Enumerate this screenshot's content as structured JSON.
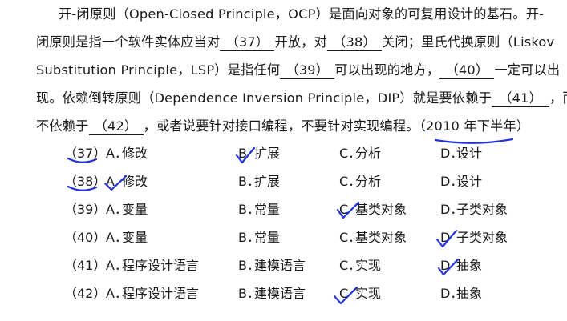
{
  "paragraph": {
    "lines": [
      {
        "text": "开-闭原则（Open-Closed Principle，OCP）是面向对象的可复用设计的基石。开-"
      },
      {
        "pre": "闭原则是指一个软件实体应当对",
        "blank1": "（37）",
        "mid": "开放，对",
        "blank2": "（38）",
        "post": "关闭；里氏代换原则（Liskov"
      },
      {
        "pre": "Substitution Principle，LSP）是指任何",
        "blank1": "（39）",
        "mid": "可以出现的地方，",
        "blank2": "（40）",
        "post": "一定可以出"
      },
      {
        "pre": "现。依赖倒转原则（Dependence Inversion Principle，DIP）就是要依赖于",
        "blank1": "（41）",
        "post": "，而"
      },
      {
        "pre": "不依赖于",
        "blank1": "（42）",
        "mid": "，或者说要针对接口编程，不要针对实现编程。（",
        "source": "2010 年下半年",
        "post": "）"
      }
    ]
  },
  "questions": [
    {
      "num": "（37）",
      "options": [
        {
          "letter": "A．",
          "text": "修改"
        },
        {
          "letter": "B",
          "text": "扩展"
        },
        {
          "letter": "C．",
          "text": "分析"
        },
        {
          "letter": "D．",
          "text": "设计"
        }
      ]
    },
    {
      "num": "（38）",
      "options": [
        {
          "letter": "A",
          "text": "修改"
        },
        {
          "letter": "B．",
          "text": "扩展"
        },
        {
          "letter": "C．",
          "text": "分析"
        },
        {
          "letter": "D．",
          "text": "设计"
        }
      ]
    },
    {
      "num": "（39）",
      "options": [
        {
          "letter": "A．",
          "text": "变量"
        },
        {
          "letter": "B．",
          "text": "常量"
        },
        {
          "letter": "C",
          "text": "基类对象"
        },
        {
          "letter": "D．",
          "text": "子类对象"
        }
      ]
    },
    {
      "num": "（40）",
      "options": [
        {
          "letter": "A．",
          "text": "变量"
        },
        {
          "letter": "B．",
          "text": "常量"
        },
        {
          "letter": "C．",
          "text": "基类对象"
        },
        {
          "letter": "D",
          "text": "子类对象"
        }
      ]
    },
    {
      "num": "（41）",
      "options": [
        {
          "letter": "A．",
          "text": "程序设计语言"
        },
        {
          "letter": "B．",
          "text": "建模语言"
        },
        {
          "letter": "C．",
          "text": "实现"
        },
        {
          "letter": "D",
          "text": "抽象"
        }
      ]
    },
    {
      "num": "（42）",
      "options": [
        {
          "letter": "A．",
          "text": "程序设计语言"
        },
        {
          "letter": "B．",
          "text": "建模语言"
        },
        {
          "letter": "C",
          "text": "实现"
        },
        {
          "letter": "D．",
          "text": "抽象"
        }
      ]
    }
  ],
  "annotation_color": "#2233dd"
}
